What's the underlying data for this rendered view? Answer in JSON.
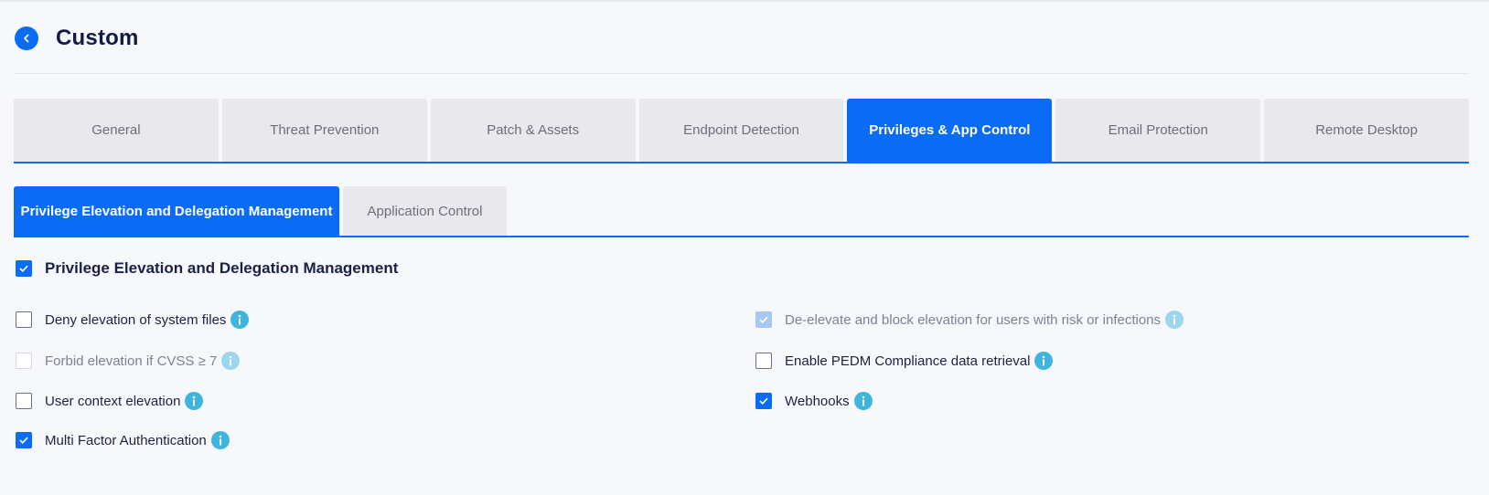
{
  "header": {
    "title": "Custom"
  },
  "tabs": [
    {
      "label": "General",
      "active": false
    },
    {
      "label": "Threat Prevention",
      "active": false
    },
    {
      "label": "Patch & Assets",
      "active": false
    },
    {
      "label": "Endpoint Detection",
      "active": false
    },
    {
      "label": "Privileges & App Control",
      "active": true
    },
    {
      "label": "Email Protection",
      "active": false
    },
    {
      "label": "Remote Desktop",
      "active": false
    }
  ],
  "subtabs": [
    {
      "label": "Privilege Elevation and Delegation Management",
      "active": true
    },
    {
      "label": "Application Control",
      "active": false
    }
  ],
  "section": {
    "label": "Privilege Elevation and Delegation Management",
    "checked": true
  },
  "options": [
    {
      "label": "Deny elevation of system files",
      "state": "unchecked"
    },
    {
      "label": "Forbid elevation if CVSS ≥ 7",
      "state": "disabled"
    },
    {
      "label": "User context elevation",
      "state": "unchecked"
    },
    {
      "label": "Multi Factor Authentication",
      "state": "checked"
    },
    {
      "label": "De-elevate and block elevation for users with risk or infections",
      "state": "disabled-checked"
    },
    {
      "label": "Enable PEDM Compliance data retrieval",
      "state": "unchecked"
    },
    {
      "label": "Webhooks",
      "state": "checked"
    }
  ],
  "colors": {
    "accent": "#0a6cf5",
    "info": "#3fb5dd",
    "tab_inactive": "#e9e9ed"
  },
  "icons": {
    "back": "chevron-left-icon",
    "check": "check-icon",
    "info": "info-icon"
  }
}
